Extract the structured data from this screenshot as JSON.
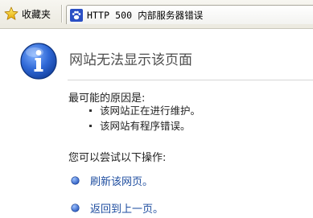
{
  "toolbar": {
    "favorites_label": "收藏夹",
    "tab_title": "HTTP 500 内部服务器错误"
  },
  "content": {
    "title": "网站无法显示该页面",
    "reason_heading": "最可能的原因是:",
    "reasons": [
      "该网站正在进行维护。",
      "该网站有程序错误。"
    ],
    "try_heading": "您可以尝试以下操作:",
    "actions": [
      "刷新该网页。",
      "返回到上一页。"
    ]
  },
  "icons": {
    "favorites": "star-icon",
    "tab": "paw-icon",
    "info": "info-icon",
    "action_bullet": "blue-bullet-icon"
  },
  "colors": {
    "link": "#1f4ea0",
    "info_blue": "#1f5fbf",
    "title_text": "#4e4e4e"
  }
}
